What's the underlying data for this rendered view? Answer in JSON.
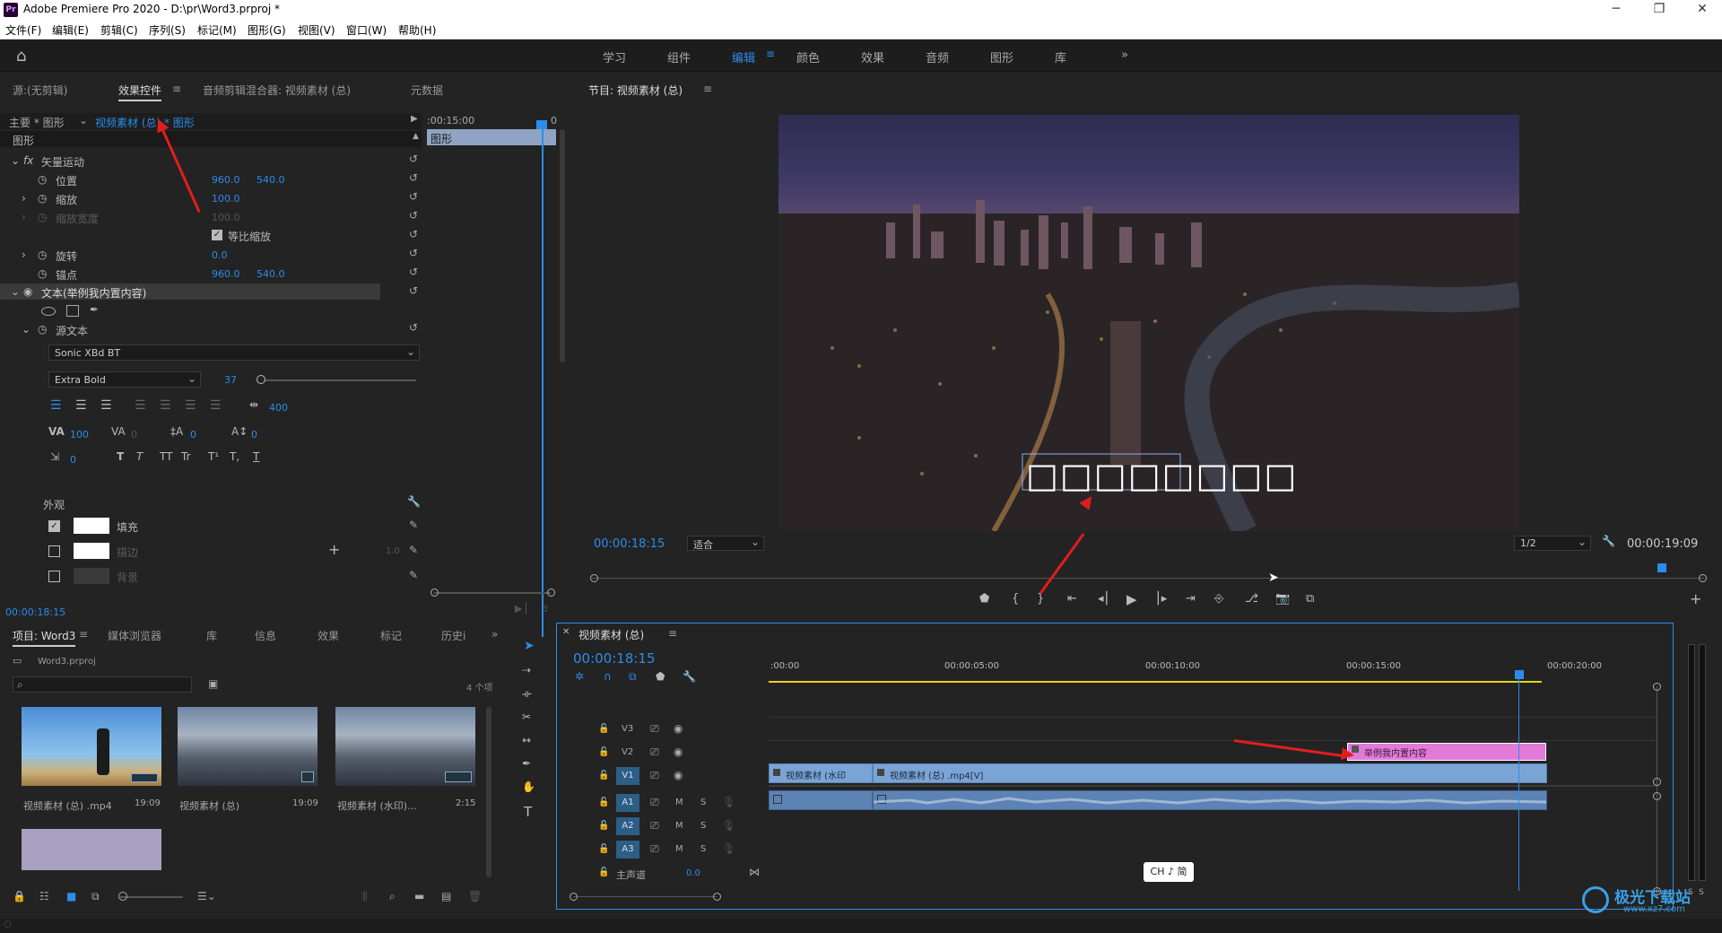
{
  "app": {
    "title": "Adobe Premiere Pro 2020 - D:\\pr\\Word3.prproj *",
    "logo": "Pr"
  },
  "menu": [
    "文件(F)",
    "编辑(E)",
    "剪辑(C)",
    "序列(S)",
    "标记(M)",
    "图形(G)",
    "视图(V)",
    "窗口(W)",
    "帮助(H)"
  ],
  "workspaces": {
    "items": [
      "学习",
      "组件",
      "编辑",
      "颜色",
      "效果",
      "音频",
      "图形",
      "库"
    ],
    "active": "编辑",
    "more": "»"
  },
  "left_panel": {
    "tabs": [
      "源:(无剪辑)",
      "效果控件",
      "音频剪辑混合器: 视频素材 (总)",
      "元数据"
    ],
    "active_tab": "效果控件",
    "menu_icon": "≡",
    "crumb_main": "主要 * 图形",
    "crumb_seq": "视频素材 (总) * 图形",
    "timecode_top": ":00:15:00",
    "zero": "0",
    "clip_label": "图形",
    "section": "图形",
    "vector_motion": "矢量运动",
    "fx": "fx",
    "position": {
      "label": "位置",
      "x": "960.0",
      "y": "540.0"
    },
    "scale": {
      "label": "缩放",
      "value": "100.0"
    },
    "scale_width": {
      "label": "缩放宽度",
      "value": "100.0"
    },
    "uniform": "等比缩放",
    "rotation": {
      "label": "旋转",
      "value": "0.0"
    },
    "anchor": {
      "label": "锚点",
      "x": "960.0",
      "y": "540.0"
    },
    "text_layer": "文本(举例我内置内容)",
    "source_text": "源文本",
    "font": "Sonic XBd BT",
    "font_style": "Extra Bold",
    "font_size": "37",
    "tracking": "400",
    "kerning": "100",
    "va": "0",
    "leading": "0",
    "baseline": "0",
    "tsume": "0",
    "text_styles": [
      "T",
      "T",
      "TT",
      "Tr",
      "T¹",
      "T,",
      "T"
    ],
    "appearance": "外观",
    "fill": "填充",
    "stroke": "描边",
    "stroke_width": "1.0",
    "background": "背景",
    "bottom_tc": "00:00:18:15"
  },
  "program": {
    "title": "节目: 视频素材 (总)",
    "menu_icon": "≡",
    "timecode": "00:00:18:15",
    "fit": "适合",
    "quality": "1/2",
    "duration": "00:00:19:09",
    "overlay_text": "□□□□□□□□"
  },
  "project": {
    "tabs": [
      "项目: Word3",
      "媒体浏览器",
      "库",
      "信息",
      "效果",
      "标记",
      "历史i"
    ],
    "active_tab": "项目: Word3",
    "file": "Word3.prproj",
    "count": "4 个项",
    "items": [
      {
        "name": "视频素材 (总) .mp4",
        "dur": "19:09"
      },
      {
        "name": "视频素材 (总)",
        "dur": "19:09"
      },
      {
        "name": "视频素材 (水印)...",
        "dur": "2:15"
      },
      {
        "name": "",
        "dur": ""
      }
    ]
  },
  "timeline": {
    "title": "视频素材 (总)",
    "menu_icon": "≡",
    "timecode": "00:00:18:15",
    "ruler": [
      ":00:00",
      "00:00:05:00",
      "00:00:10:00",
      "00:00:15:00",
      "00:00:20:00"
    ],
    "tracks": {
      "v": [
        "V3",
        "V2",
        "V1"
      ],
      "a": [
        "A1",
        "A2",
        "A3"
      ],
      "master": "主声道",
      "master_val": "0.0"
    },
    "clips": {
      "v1a": "视频素材 (水印",
      "v1b": "视频素材 (总) .mp4[V]",
      "v2": "举例我内置内容"
    },
    "ime": "CH ♪ 简"
  },
  "meter": {
    "s_left": "S",
    "s_right": "S"
  },
  "watermark": "极光下载站",
  "watermark_url": "www.xz7.com"
}
